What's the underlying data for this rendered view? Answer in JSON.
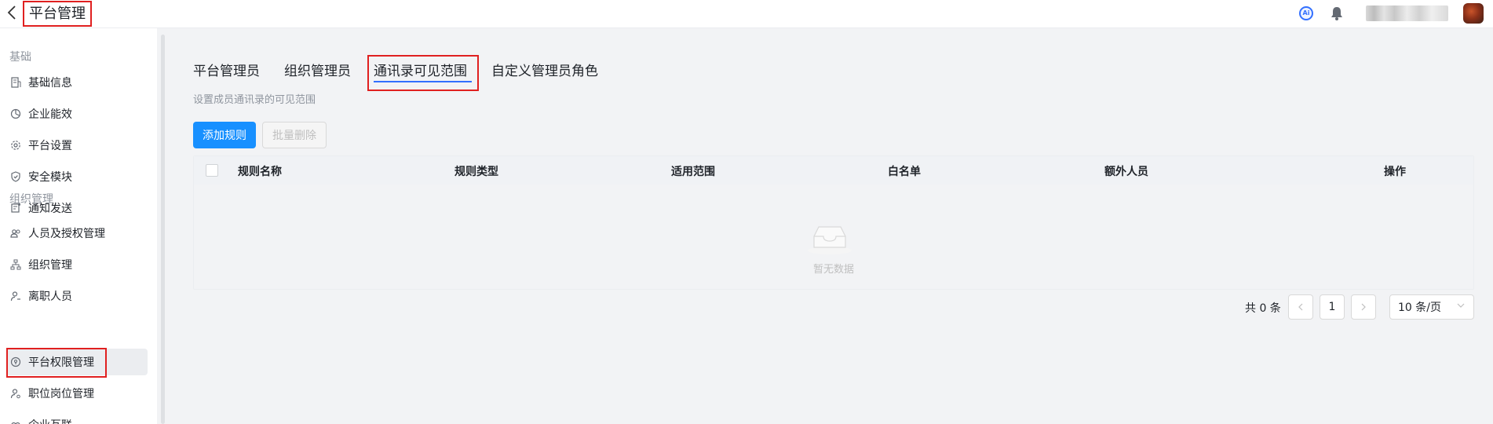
{
  "header": {
    "title": "平台管理",
    "ai_icon_text": "Ai"
  },
  "sidebar": {
    "groups": [
      {
        "label": "基础"
      },
      {
        "label": "组织管理"
      }
    ],
    "items": [
      {
        "label": "基础信息",
        "icon": "building-icon"
      },
      {
        "label": "企业能效",
        "icon": "chart-pie-icon"
      },
      {
        "label": "平台设置",
        "icon": "gear-icon"
      },
      {
        "label": "安全模块",
        "icon": "shield-icon"
      },
      {
        "label": "通知发送",
        "icon": "notice-icon"
      },
      {
        "label": "人员及授权管理",
        "icon": "users-icon"
      },
      {
        "label": "组织管理",
        "icon": "org-tree-icon"
      },
      {
        "label": "离职人员",
        "icon": "user-leave-icon"
      },
      {
        "label": "平台权限管理",
        "icon": "permission-icon"
      },
      {
        "label": "职位岗位管理",
        "icon": "user-job-icon"
      },
      {
        "label": "企业互联",
        "icon": "link-icon"
      }
    ]
  },
  "tabs": [
    {
      "label": "平台管理员"
    },
    {
      "label": "组织管理员"
    },
    {
      "label": "通讯录可见范围"
    },
    {
      "label": "自定义管理员角色"
    }
  ],
  "description": "设置成员通讯录的可见范围",
  "buttons": {
    "add_rule": "添加规则",
    "batch_delete": "批量删除"
  },
  "table": {
    "columns": [
      "规则名称",
      "规则类型",
      "适用范围",
      "白名单",
      "额外人员",
      "操作"
    ],
    "rows": [],
    "empty_text": "暂无数据"
  },
  "pagination": {
    "total_text": "共 0 条",
    "current_page": "1",
    "page_size": "10 条/页"
  },
  "colors": {
    "primary": "#1890ff",
    "tab_underline": "#3370ff",
    "highlight_border": "#e02020"
  }
}
